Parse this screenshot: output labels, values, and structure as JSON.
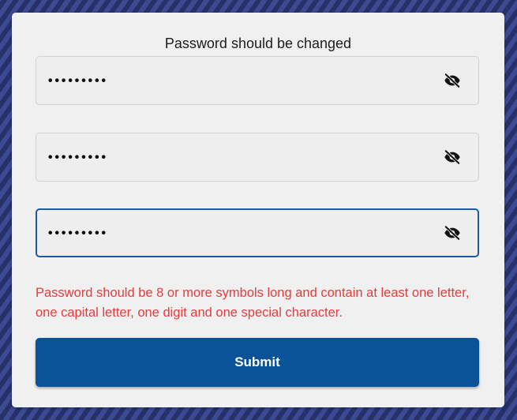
{
  "form": {
    "title": "Password should be changed",
    "fields": [
      {
        "value": "•••••••••",
        "icon": "eye-off-icon",
        "focused": false
      },
      {
        "value": "•••••••••",
        "icon": "eye-off-icon",
        "focused": false
      },
      {
        "value": "•••••••••",
        "icon": "eye-off-icon",
        "focused": true
      }
    ],
    "error": "Password should be 8 or more symbols long and contain at least one letter, one capital letter, one digit and one special character.",
    "submit_label": "Submit"
  },
  "colors": {
    "card_bg": "#f0f0f0",
    "error": "#e63b3b",
    "primary": "#0a5399",
    "focus_border": "#1f5aa0"
  }
}
